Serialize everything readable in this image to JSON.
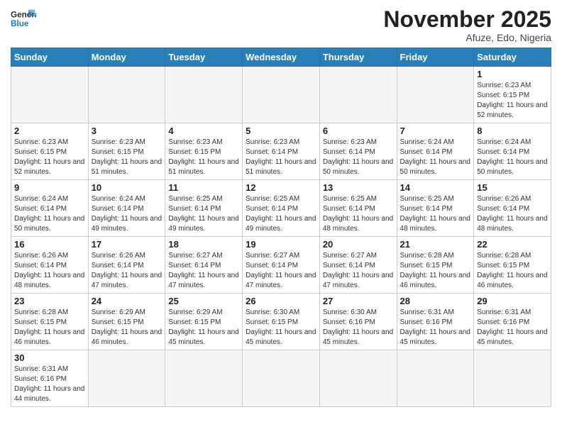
{
  "header": {
    "logo_general": "General",
    "logo_blue": "Blue",
    "month_year": "November 2025",
    "location": "Afuze, Edo, Nigeria"
  },
  "days_of_week": [
    "Sunday",
    "Monday",
    "Tuesday",
    "Wednesday",
    "Thursday",
    "Friday",
    "Saturday"
  ],
  "weeks": [
    [
      {
        "day": "",
        "empty": true
      },
      {
        "day": "",
        "empty": true
      },
      {
        "day": "",
        "empty": true
      },
      {
        "day": "",
        "empty": true
      },
      {
        "day": "",
        "empty": true
      },
      {
        "day": "",
        "empty": true
      },
      {
        "day": "1",
        "sunrise": "6:23 AM",
        "sunset": "6:15 PM",
        "daylight": "11 hours and 52 minutes."
      }
    ],
    [
      {
        "day": "2",
        "sunrise": "6:23 AM",
        "sunset": "6:15 PM",
        "daylight": "11 hours and 52 minutes."
      },
      {
        "day": "3",
        "sunrise": "6:23 AM",
        "sunset": "6:15 PM",
        "daylight": "11 hours and 51 minutes."
      },
      {
        "day": "4",
        "sunrise": "6:23 AM",
        "sunset": "6:15 PM",
        "daylight": "11 hours and 51 minutes."
      },
      {
        "day": "5",
        "sunrise": "6:23 AM",
        "sunset": "6:14 PM",
        "daylight": "11 hours and 51 minutes."
      },
      {
        "day": "6",
        "sunrise": "6:23 AM",
        "sunset": "6:14 PM",
        "daylight": "11 hours and 50 minutes."
      },
      {
        "day": "7",
        "sunrise": "6:24 AM",
        "sunset": "6:14 PM",
        "daylight": "11 hours and 50 minutes."
      },
      {
        "day": "8",
        "sunrise": "6:24 AM",
        "sunset": "6:14 PM",
        "daylight": "11 hours and 50 minutes."
      }
    ],
    [
      {
        "day": "9",
        "sunrise": "6:24 AM",
        "sunset": "6:14 PM",
        "daylight": "11 hours and 50 minutes."
      },
      {
        "day": "10",
        "sunrise": "6:24 AM",
        "sunset": "6:14 PM",
        "daylight": "11 hours and 49 minutes."
      },
      {
        "day": "11",
        "sunrise": "6:25 AM",
        "sunset": "6:14 PM",
        "daylight": "11 hours and 49 minutes."
      },
      {
        "day": "12",
        "sunrise": "6:25 AM",
        "sunset": "6:14 PM",
        "daylight": "11 hours and 49 minutes."
      },
      {
        "day": "13",
        "sunrise": "6:25 AM",
        "sunset": "6:14 PM",
        "daylight": "11 hours and 48 minutes."
      },
      {
        "day": "14",
        "sunrise": "6:25 AM",
        "sunset": "6:14 PM",
        "daylight": "11 hours and 48 minutes."
      },
      {
        "day": "15",
        "sunrise": "6:26 AM",
        "sunset": "6:14 PM",
        "daylight": "11 hours and 48 minutes."
      }
    ],
    [
      {
        "day": "16",
        "sunrise": "6:26 AM",
        "sunset": "6:14 PM",
        "daylight": "11 hours and 48 minutes."
      },
      {
        "day": "17",
        "sunrise": "6:26 AM",
        "sunset": "6:14 PM",
        "daylight": "11 hours and 47 minutes."
      },
      {
        "day": "18",
        "sunrise": "6:27 AM",
        "sunset": "6:14 PM",
        "daylight": "11 hours and 47 minutes."
      },
      {
        "day": "19",
        "sunrise": "6:27 AM",
        "sunset": "6:14 PM",
        "daylight": "11 hours and 47 minutes."
      },
      {
        "day": "20",
        "sunrise": "6:27 AM",
        "sunset": "6:14 PM",
        "daylight": "11 hours and 47 minutes."
      },
      {
        "day": "21",
        "sunrise": "6:28 AM",
        "sunset": "6:15 PM",
        "daylight": "11 hours and 46 minutes."
      },
      {
        "day": "22",
        "sunrise": "6:28 AM",
        "sunset": "6:15 PM",
        "daylight": "11 hours and 46 minutes."
      }
    ],
    [
      {
        "day": "23",
        "sunrise": "6:28 AM",
        "sunset": "6:15 PM",
        "daylight": "11 hours and 46 minutes."
      },
      {
        "day": "24",
        "sunrise": "6:29 AM",
        "sunset": "6:15 PM",
        "daylight": "11 hours and 46 minutes."
      },
      {
        "day": "25",
        "sunrise": "6:29 AM",
        "sunset": "6:15 PM",
        "daylight": "11 hours and 45 minutes."
      },
      {
        "day": "26",
        "sunrise": "6:30 AM",
        "sunset": "6:15 PM",
        "daylight": "11 hours and 45 minutes."
      },
      {
        "day": "27",
        "sunrise": "6:30 AM",
        "sunset": "6:16 PM",
        "daylight": "11 hours and 45 minutes."
      },
      {
        "day": "28",
        "sunrise": "6:31 AM",
        "sunset": "6:16 PM",
        "daylight": "11 hours and 45 minutes."
      },
      {
        "day": "29",
        "sunrise": "6:31 AM",
        "sunset": "6:16 PM",
        "daylight": "11 hours and 45 minutes."
      }
    ],
    [
      {
        "day": "30",
        "sunrise": "6:31 AM",
        "sunset": "6:16 PM",
        "daylight": "11 hours and 44 minutes."
      },
      {
        "day": "",
        "empty": true
      },
      {
        "day": "",
        "empty": true
      },
      {
        "day": "",
        "empty": true
      },
      {
        "day": "",
        "empty": true
      },
      {
        "day": "",
        "empty": true
      },
      {
        "day": "",
        "empty": true
      }
    ]
  ],
  "labels": {
    "sunrise_prefix": "Sunrise: ",
    "sunset_prefix": "Sunset: ",
    "daylight_prefix": "Daylight: "
  }
}
